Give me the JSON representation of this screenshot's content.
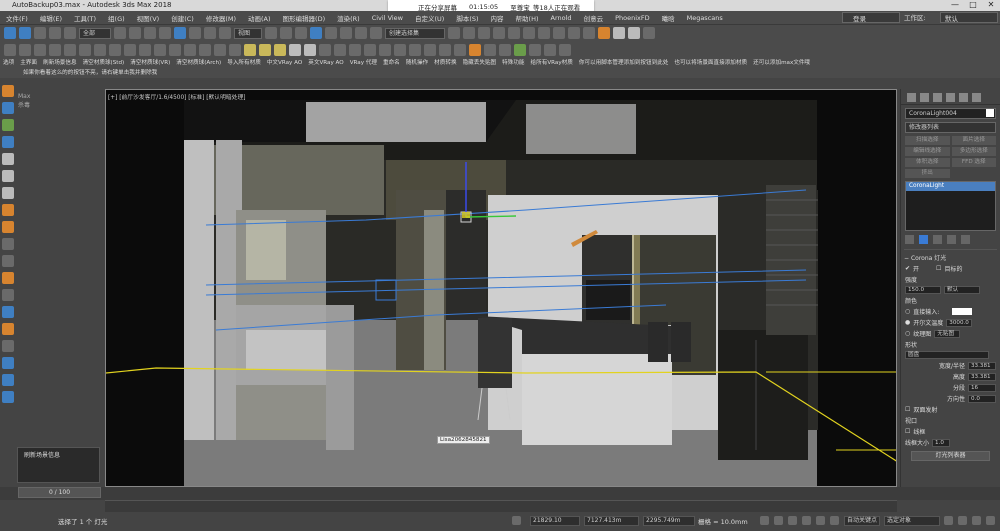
{
  "window": {
    "title": "AutoBackup03.max - Autodesk 3ds Max 2018",
    "controls": [
      "—",
      "□",
      "✕"
    ]
  },
  "share": {
    "sharing": "正在分享屏幕",
    "time": "01:15:05",
    "viewers": "至尊宝_等18人正在观看"
  },
  "menu": {
    "items": [
      "文件(F)",
      "编辑(E)",
      "工具(T)",
      "组(G)",
      "视图(V)",
      "创建(C)",
      "修改器(M)",
      "动画(A)",
      "图形编辑器(D)",
      "渲染(R)",
      "Civil View",
      "自定义(U)",
      "脚本(S)",
      "内容",
      "帮助(H)",
      "Arnold",
      "创意云",
      "PhoenixFD",
      "曦晗",
      "Megascans"
    ],
    "login": "登录",
    "workspace_label": "工作区:",
    "workspace_value": "默认"
  },
  "toolbar1": {
    "filter": "全部",
    "view": "视图",
    "selection_set": "创建选择集"
  },
  "toolbar3": {
    "items": [
      "选项",
      "主界面",
      "刷新场景信息",
      "清空材质球(Std)",
      "清空材质球(VR)",
      "清空材质球(Arch)",
      "导入所有材质",
      "中文VRay AO",
      "英文VRay AO",
      "VRay 代理",
      "重命名",
      "随机操作",
      "材质转换",
      "隐藏丢失贴图",
      "特殊功能",
      "给所有VRay材质",
      "你可以用脚本管理添加到按钮到此处",
      "也可以将场景面直接添加材质",
      "还可以添加max文件哦"
    ]
  },
  "toolbar4": {
    "note": "如果你看着这么的的按钮不亮，请右键单击我并删除我"
  },
  "left": {
    "max_label": "Max",
    "max_sub": "杀毒"
  },
  "viewport": {
    "label": "[+] [前厅沙发客厅/1.6/4500] [标准] [默认明暗处理]",
    "tooltip": "Lisa2062845821"
  },
  "rightpanel": {
    "object_name": "CoronaLight004",
    "modifier_list": "修改器列表",
    "buttons": [
      "扫描选择",
      "面片选择",
      "编辑线选择",
      "多边形选择",
      "体积选择",
      "FFD 选择",
      "挤出"
    ],
    "stack_item": "CoronaLight",
    "rollout_title": "Corona 灯光",
    "on_label": "开",
    "targeted_label": "目标的",
    "intensity_label": "强度",
    "intensity_value": "150.0",
    "intensity_unit": "默认",
    "color_label": "颜色",
    "direct_input": "直接输入:",
    "kelvin_label": "开尔文温度",
    "kelvin_value": "3000.0",
    "texture_label": "纹理图",
    "texture_value": "无贴图",
    "shape_label": "形状",
    "shape_value": "圆盘",
    "wh_label": "宽度/半径",
    "wh_value": "33.381",
    "height_label": "高度",
    "height_value": "33.381",
    "seg_label": "分段",
    "seg_value": "16",
    "dir_label": "方向性",
    "dir_value": "0.0",
    "twosided": "双面发射",
    "viewport_label": "视口",
    "wire_label": "线框",
    "wire_size_label": "线框大小",
    "wire_size_value": "1.0",
    "lister_button": "灯光列表器"
  },
  "cmd": {
    "text": "刷新场景信息"
  },
  "timeline": {
    "frame": "0 / 100"
  },
  "status": {
    "selected": "选择了 1 个 灯光",
    "x": "21829.10",
    "y": "7127.413m",
    "z": "2295.749m",
    "grid": "栅格 = 10.0mm",
    "autokey": "自动关键点",
    "setkey": "选定对象"
  }
}
